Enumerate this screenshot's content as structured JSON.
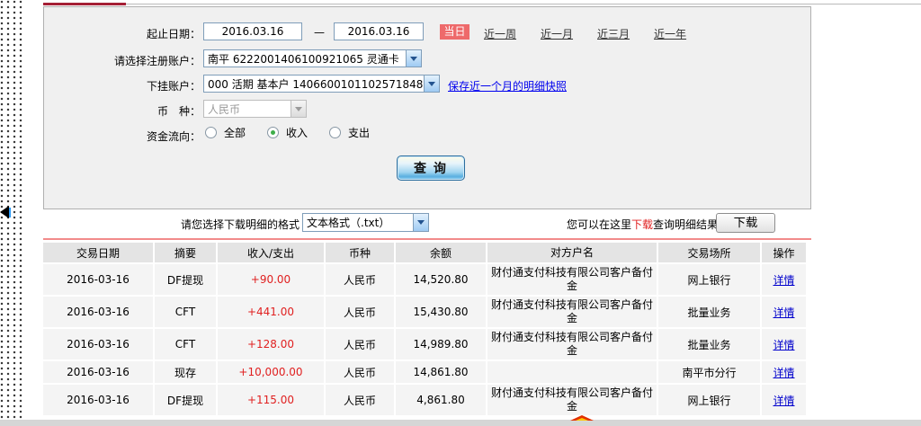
{
  "form": {
    "date_label": "起止日期：",
    "date_from": "2016.03.16",
    "date_separator": "—",
    "date_to": "2016.03.16",
    "today_badge": "当日",
    "quick_links": [
      "近一周",
      "近一月",
      "近三月",
      "近一年"
    ],
    "account_label": "请选择注册账户：",
    "account_value": "南平 6222001406100921065 灵通卡",
    "sub_account_label": "下挂账户：",
    "sub_account_value": "000 活期 基本户 1406600101102571848",
    "snapshot_link": "保存近一个月的明细快照",
    "currency_label": "币　种：",
    "currency_value": "人民币",
    "flow_label": "资金流向：",
    "flow_options": [
      {
        "label": "全部",
        "selected": false
      },
      {
        "label": "收入",
        "selected": true
      },
      {
        "label": "支出",
        "selected": false
      }
    ],
    "query_button": "查 询"
  },
  "download": {
    "format_label": "请您选择下载明细的格式",
    "format_value": "文本格式（.txt）",
    "hint_prefix": "您可以在这里",
    "hint_download": "下载",
    "hint_suffix": "查询明细结果",
    "button": "下载"
  },
  "table": {
    "headers": [
      "交易日期",
      "摘要",
      "收入/支出",
      "币种",
      "余额",
      "对方户名",
      "交易场所",
      "操作"
    ],
    "rows": [
      {
        "date": "2016-03-16",
        "summary": "DF提现",
        "amount": "+90.00",
        "currency": "人民币",
        "balance": "14,520.80",
        "counterparty": "财付通支付科技有限公司客户备付金",
        "place": "网上银行",
        "action": "详情"
      },
      {
        "date": "2016-03-16",
        "summary": "CFT",
        "amount": "+441.00",
        "currency": "人民币",
        "balance": "15,430.80",
        "counterparty": "财付通支付科技有限公司客户备付金",
        "place": "批量业务",
        "action": "详情"
      },
      {
        "date": "2016-03-16",
        "summary": "CFT",
        "amount": "+128.00",
        "currency": "人民币",
        "balance": "14,989.80",
        "counterparty": "财付通支付科技有限公司客户备付金",
        "place": "批量业务",
        "action": "详情"
      },
      {
        "date": "2016-03-16",
        "summary": "现存",
        "amount": "+10,000.00",
        "currency": "人民币",
        "balance": "14,861.80",
        "counterparty": "",
        "place": "南平市分行",
        "action": "详情"
      },
      {
        "date": "2016-03-16",
        "summary": "DF提现",
        "amount": "+115.00",
        "currency": "人民币",
        "balance": "4,861.80",
        "counterparty": "财付通支付科技有限公司客户备付金",
        "place": "网上银行",
        "action": "详情"
      }
    ]
  },
  "colors": {
    "badge_red": "#ee6a6b",
    "amount_red": "#e02020",
    "link_blue": "#0000cc",
    "divider_salmon": "#f28b8b",
    "topline_red": "#a51f35"
  }
}
